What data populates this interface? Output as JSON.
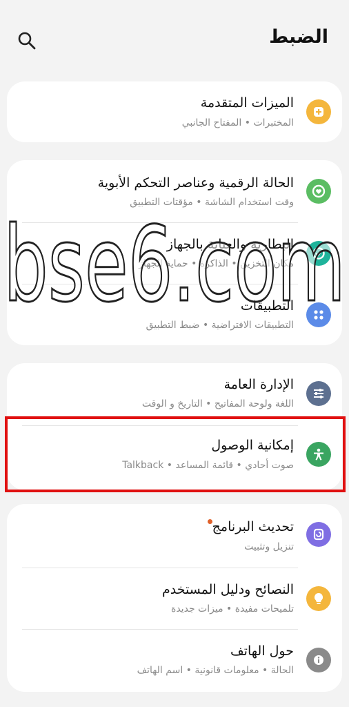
{
  "header": {
    "title": "الضبط",
    "search_icon": "search-icon"
  },
  "cards": {
    "advanced": {
      "label": "الميزات المتقدمة",
      "sub": "المختبرات  •  المفتاح الجانبي",
      "icon": "plus-gear-icon",
      "color": "#f4b63c"
    },
    "wellbeing": {
      "label": "الحالة الرقمية وعناصر التحكم الأبوية",
      "sub": "وقت استخدام الشاشة  •  مؤقتات التطبيق",
      "icon": "heart-circle-icon",
      "color": "#5bbd63"
    },
    "battery": {
      "label": "البطارية والعناية بالجهاز",
      "sub": "مكان التخزين  •  الذاكرة  •  حماية الجهاز",
      "icon": "device-care-icon",
      "color": "#1fb39b"
    },
    "apps": {
      "label": "التطبيقات",
      "sub": "التطبيقات الافتراضية  •  ضبط التطبيق",
      "icon": "apps-grid-icon",
      "color": "#5b8be8"
    },
    "general": {
      "label": "الإدارة العامة",
      "sub": "اللغة ولوحة المفاتيح  •  التاريخ و الوقت",
      "icon": "sliders-icon",
      "color": "#5d7090"
    },
    "accessibility": {
      "label": "إمكانية الوصول",
      "sub": "صوت أحادي  •  قائمة المساعد  •  Talkback",
      "icon": "accessibility-person-icon",
      "color": "#3aa561"
    },
    "update": {
      "label": "تحديث البرنامج",
      "sub": "تنزيل وتثبيت",
      "icon": "software-update-icon",
      "color": "#7f6ee3"
    },
    "tips": {
      "label": "النصائح ودليل المستخدم",
      "sub": "تلميحات مفيدة  •  ميزات جديدة",
      "icon": "lightbulb-icon",
      "color": "#f4b63c"
    },
    "about": {
      "label": "حول الهاتف",
      "sub": "الحالة  •  معلومات قانونية  •  اسم الهاتف",
      "icon": "info-icon",
      "color": "#8a8a8a"
    }
  },
  "watermark": {
    "text": "bse6.com"
  }
}
